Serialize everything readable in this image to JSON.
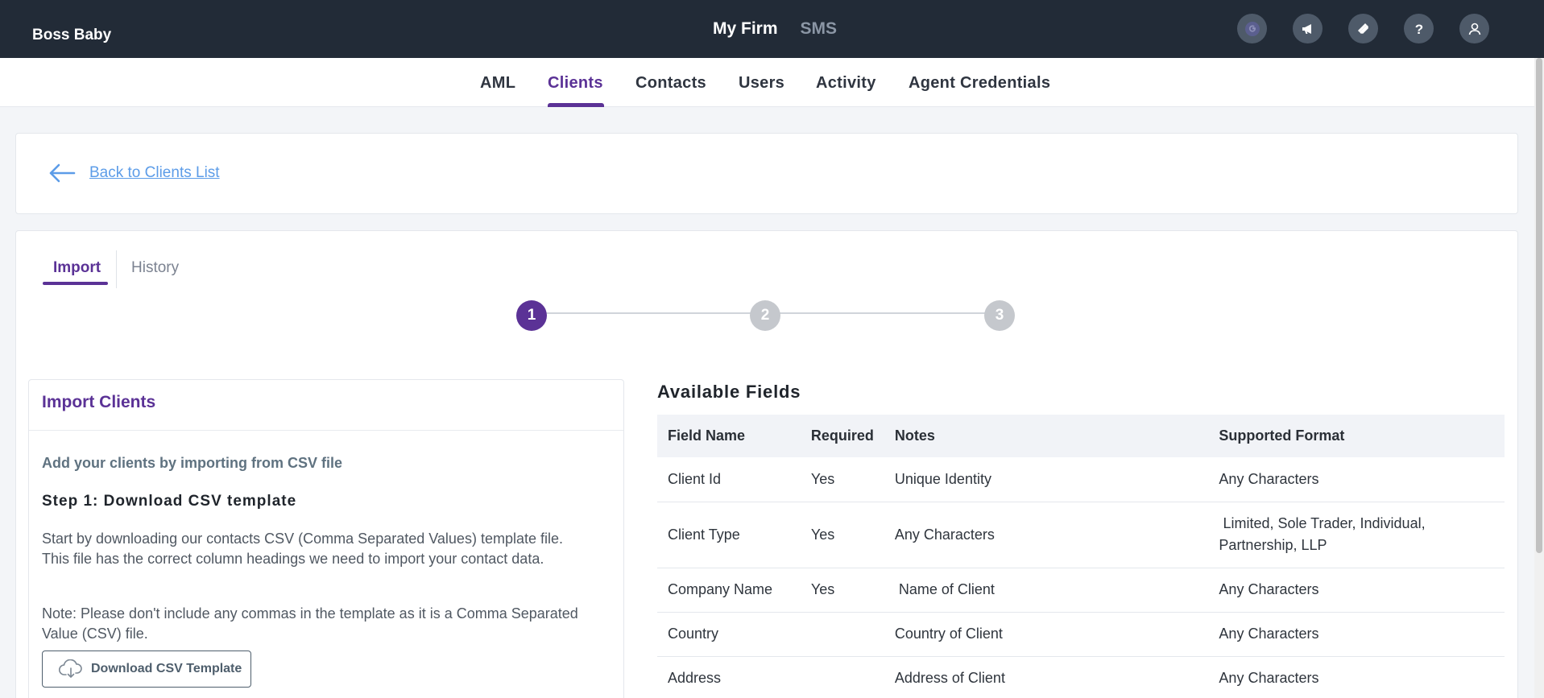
{
  "topbar": {
    "brand": "Boss Baby",
    "nav": [
      {
        "label": "My Firm",
        "active": true
      },
      {
        "label": "SMS",
        "active": false
      }
    ],
    "icons": [
      "google-icon",
      "megaphone-icon",
      "ticket-icon",
      "help-icon",
      "user-icon"
    ]
  },
  "subnav": {
    "tabs": [
      "AML",
      "Clients",
      "Contacts",
      "Users",
      "Activity",
      "Agent Credentials"
    ],
    "active": "Clients"
  },
  "back": {
    "label": "Back to Clients List"
  },
  "tabs": {
    "import": "Import",
    "history": "History",
    "active": "Import"
  },
  "stepper": {
    "steps": [
      "1",
      "2",
      "3"
    ],
    "current": "1"
  },
  "import_panel": {
    "title": "Import Clients",
    "subtitle": "Add your clients by importing from CSV file",
    "step_heading": "Step 1: Download CSV template",
    "para1_line1": "Start by downloading our contacts CSV (Comma Separated Values) template file.",
    "para1_line2": "This file has the correct column headings we need to import your contact data.",
    "para2_line1": "Note: Please don't include any commas in the template as it is a Comma Separated",
    "para2_line2": "Value (CSV) file.",
    "download_button": "Download CSV Template"
  },
  "available_fields": {
    "title": "Available Fields",
    "headers": [
      "Field Name",
      "Required",
      "Notes",
      "Supported Format"
    ],
    "rows": [
      [
        "Client Id",
        "Yes",
        "Unique Identity",
        "Any Characters"
      ],
      [
        "Client Type",
        "Yes",
        "Any Characters",
        " Limited, Sole Trader, Individual, Partnership, LLP"
      ],
      [
        "Company Name",
        "Yes",
        " Name of Client",
        "Any Characters"
      ],
      [
        "Country",
        "",
        "Country of Client",
        "Any Characters"
      ],
      [
        "Address",
        "",
        "Address of Client",
        "Any Characters"
      ]
    ]
  },
  "colors": {
    "topbar": "#222b37",
    "accent": "#5b3296",
    "link": "#5c9ce8"
  }
}
